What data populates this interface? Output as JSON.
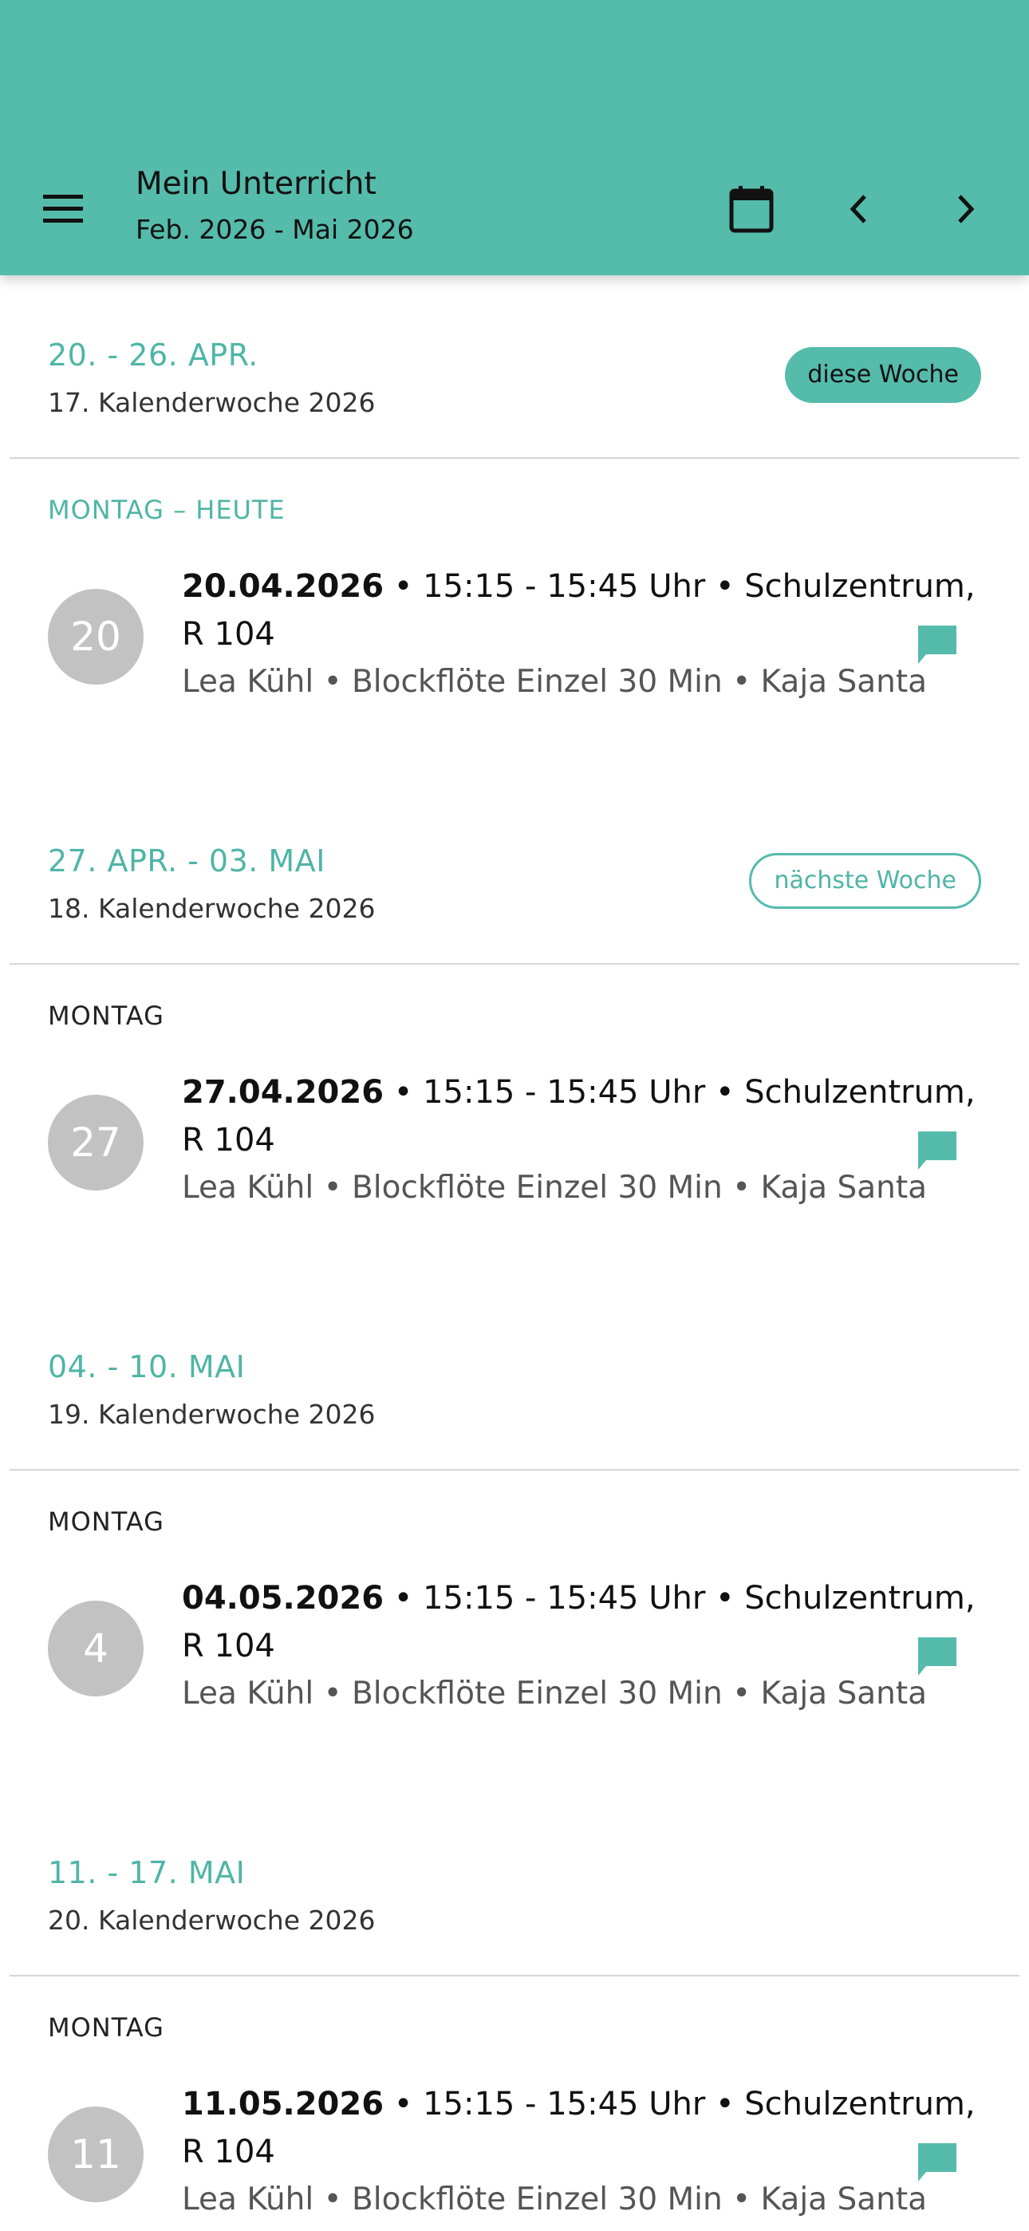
{
  "header": {
    "title": "Mein Unterricht",
    "subtitle": "Feb. 2026 - Mai 2026",
    "icons": [
      "menu-icon",
      "calendar-icon",
      "chevron-left-icon",
      "chevron-right-icon"
    ]
  },
  "colors": {
    "primary": "#55bbab",
    "accent_text": "#4fb5a6",
    "avatar": "#c2c2c2"
  },
  "weeks": [
    {
      "range": "20. - 26. APR.",
      "kw": "17. Kalenderwoche 2026",
      "badge": "diese Woche",
      "badge_style": "filled",
      "day_label": "MONTAG – HEUTE",
      "day_today": true,
      "day_num": "20",
      "date": "20.04.2026",
      "line1_rest": " • 15:15 - 15:45 Uhr • Schulzentrum,",
      "line2": "R 104",
      "line3": "Lea Kühl • Blockflöte Einzel 30 Min • Kaja Santa"
    },
    {
      "range": "27. APR. - 03. MAI",
      "kw": "18. Kalenderwoche 2026",
      "badge": "nächste Woche",
      "badge_style": "outline",
      "day_label": "MONTAG",
      "day_today": false,
      "day_num": "27",
      "date": "27.04.2026",
      "line1_rest": " • 15:15 - 15:45 Uhr • Schulzentrum,",
      "line2": "R 104",
      "line3": "Lea Kühl • Blockflöte Einzel 30 Min • Kaja Santa"
    },
    {
      "range": "04. - 10. MAI",
      "kw": "19. Kalenderwoche 2026",
      "badge": "",
      "badge_style": "none",
      "day_label": "MONTAG",
      "day_today": false,
      "day_num": "4",
      "date": "04.05.2026",
      "line1_rest": " • 15:15 - 15:45 Uhr • Schulzentrum,",
      "line2": "R 104",
      "line3": "Lea Kühl • Blockflöte Einzel 30 Min • Kaja Santa"
    },
    {
      "range": "11. - 17. MAI",
      "kw": "20. Kalenderwoche 2026",
      "badge": "",
      "badge_style": "none",
      "day_label": "MONTAG",
      "day_today": false,
      "day_num": "11",
      "date": "11.05.2026",
      "line1_rest": " • 15:15 - 15:45 Uhr • Schulzentrum,",
      "line2": "R 104",
      "line3": "Lea Kühl • Blockflöte Einzel 30 Min • Kaja Santa"
    }
  ]
}
